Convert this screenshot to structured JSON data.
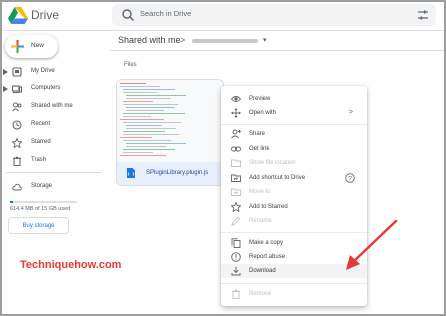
{
  "header": {
    "app_name": "Drive",
    "search_placeholder": "Search in Drive"
  },
  "sidebar": {
    "new_label": "New",
    "items": [
      {
        "label": "My Drive",
        "icon": "my-drive-icon",
        "expandable": true
      },
      {
        "label": "Computers",
        "icon": "computers-icon",
        "expandable": true
      },
      {
        "label": "Shared with me",
        "icon": "shared-with-me-icon",
        "expandable": false
      },
      {
        "label": "Recent",
        "icon": "clock-icon",
        "expandable": false
      },
      {
        "label": "Starred",
        "icon": "star-icon",
        "expandable": false
      },
      {
        "label": "Trash",
        "icon": "trash-icon",
        "expandable": false
      }
    ],
    "storage_label": "Storage",
    "storage_text": "614.4 MB of 15 GB used",
    "storage_fraction": 0.04,
    "buy_storage_label": "Buy storage"
  },
  "main": {
    "breadcrumb_root": "Shared with me",
    "breadcrumb_sep": ">",
    "section_label": "Files",
    "file": {
      "name": "SPluginLibrary.plugin.js",
      "icon": "script-file-icon"
    }
  },
  "context_menu": {
    "items": [
      {
        "label": "Preview",
        "icon": "eye-icon",
        "disabled": false
      },
      {
        "label": "Open with",
        "icon": "open-with-icon",
        "disabled": false,
        "submenu": ">"
      },
      {
        "label": "Share",
        "icon": "person-add-icon",
        "disabled": false
      },
      {
        "label": "Get link",
        "icon": "link-icon",
        "disabled": false
      },
      {
        "label": "Show file location",
        "icon": "folder-icon",
        "disabled": true
      },
      {
        "label": "Add shortcut to Drive",
        "icon": "shortcut-icon",
        "disabled": false,
        "help": "?"
      },
      {
        "label": "Move to",
        "icon": "move-icon",
        "disabled": true
      },
      {
        "label": "Add to Starred",
        "icon": "star-icon",
        "disabled": false
      },
      {
        "label": "Rename",
        "icon": "pencil-icon",
        "disabled": true
      },
      {
        "label": "Make a copy",
        "icon": "copy-icon",
        "disabled": false
      },
      {
        "label": "Report abuse",
        "icon": "report-icon",
        "disabled": false
      },
      {
        "label": "Download",
        "icon": "download-icon",
        "disabled": false
      },
      {
        "label": "Remove",
        "icon": "trash-icon",
        "disabled": true
      }
    ]
  },
  "watermark": "Techniquehow.com",
  "colors": {
    "accent": "#1a73e8",
    "annotation": "#e53935",
    "selected_file": "#e8f0fe"
  }
}
